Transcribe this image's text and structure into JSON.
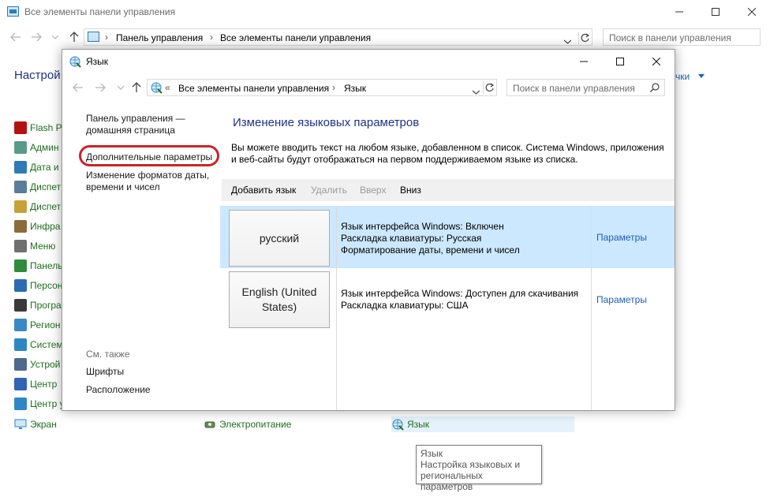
{
  "parent_window": {
    "title": "Все элементы панели управления",
    "breadcrumbs": [
      "Панель управления",
      "Все элементы панели управления"
    ],
    "search_placeholder": "Поиск в панели управления",
    "heading_partial": "Настрой",
    "view_by_partial": "чки",
    "items_left": [
      {
        "label": "Flash Pl",
        "icon": "flash-icon",
        "color": "#b3120f"
      },
      {
        "label": "Админ",
        "icon": "admin-tools-icon",
        "color": "#5a9a8a"
      },
      {
        "label": "Дата и",
        "icon": "clock-icon",
        "color": "#2f7ab5"
      },
      {
        "label": "Диспет",
        "icon": "device-manager-icon",
        "color": "#5a7d9a"
      },
      {
        "label": "Диспет",
        "icon": "credential-manager-icon",
        "color": "#c7a23a"
      },
      {
        "label": "Инфра",
        "icon": "infrared-icon",
        "color": "#8a6c3a"
      },
      {
        "label": "Меню",
        "icon": "indexing-icon",
        "color": "#6f6f6f"
      },
      {
        "label": "Панель",
        "icon": "panel-icon",
        "color": "#2e8b3c"
      },
      {
        "label": "Персон",
        "icon": "personalization-icon",
        "color": "#2b6cb0"
      },
      {
        "label": "Програ",
        "icon": "programs-icon",
        "color": "#3a3a3a"
      },
      {
        "label": "Регион",
        "icon": "region-icon",
        "color": "#3a88c8"
      },
      {
        "label": "Систем",
        "icon": "system-icon",
        "color": "#2f86c4"
      },
      {
        "label": "Устрой",
        "icon": "devices-icon",
        "color": "#4c6a8a"
      },
      {
        "label": "Центр",
        "icon": "flag-icon",
        "color": "#3262b4"
      },
      {
        "label": "Центр у",
        "icon": "ease-of-access-icon",
        "color": "#2f86c4"
      }
    ],
    "bottom_items": [
      {
        "label": "Экран",
        "icon": "display-icon"
      },
      {
        "label": "Электропитание",
        "icon": "power-icon"
      },
      {
        "label": "Язык",
        "icon": "language-icon"
      }
    ],
    "tooltip": {
      "title": "Язык",
      "line1": "Настройка языковых и",
      "line2": "региональных параметров"
    }
  },
  "dialog": {
    "title": "Язык",
    "breadcrumb_prefix": "«",
    "breadcrumbs": [
      "Все элементы панели управления",
      "Язык"
    ],
    "search_placeholder": "Поиск в панели управления",
    "sidebar": {
      "home_line1": "Панель управления —",
      "home_line2": "домашняя страница",
      "advanced": "Дополнительные параметры",
      "formats_line1": "Изменение форматов даты,",
      "formats_line2": "времени и чисел",
      "see_also": "См. также",
      "fonts": "Шрифты",
      "location": "Расположение"
    },
    "heading": "Изменение языковых параметров",
    "description_line1": "Вы можете вводить текст на любом языке, добавленном в список. Система Windows, приложения",
    "description_line2": "и веб-сайты будут отображаться на первом поддерживаемом языке из списка.",
    "toolbar": {
      "add": "Добавить язык",
      "remove": "Удалить",
      "up": "Вверх",
      "down": "Вниз"
    },
    "languages": [
      {
        "tile_line1": "русский",
        "tile_line2": "",
        "info": [
          "Язык интерфейса Windows: Включен",
          "Раскладка клавиатуры: Русская",
          "Форматирование даты, времени и чисел"
        ],
        "options": "Параметры",
        "selected": true
      },
      {
        "tile_line1": "English (United",
        "tile_line2": "States)",
        "info": [
          "Язык интерфейса Windows: Доступен для скачивания",
          "Раскладка клавиатуры: США",
          ""
        ],
        "options": "Параметры",
        "selected": false
      }
    ]
  },
  "colors": {
    "heading_blue": "#1e3287",
    "link_blue": "#1e5fb4",
    "item_green": "#1e6e1e",
    "selection": "#cce8ff",
    "highlight_circle": "#c4262b"
  }
}
